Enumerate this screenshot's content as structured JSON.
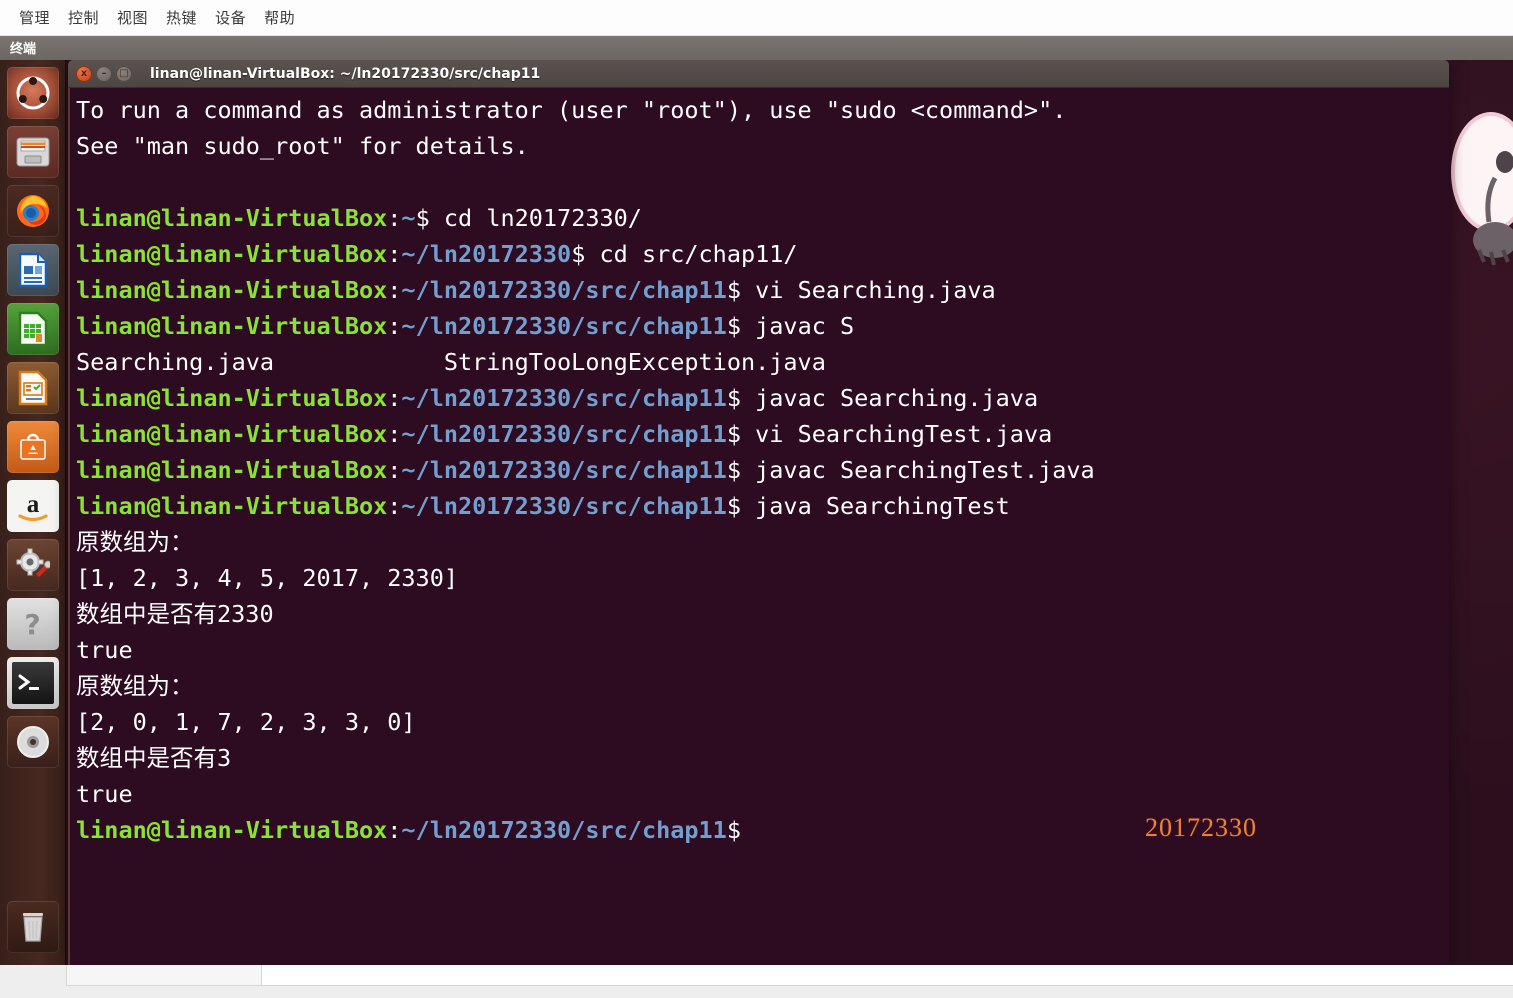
{
  "vbox": {
    "menu_items": [
      "管理",
      "控制",
      "视图",
      "热键",
      "设备",
      "帮助"
    ],
    "tab_label": "终端"
  },
  "terminal": {
    "title": "linan@linan-VirtualBox: ~/ln20172330/src/chap11",
    "bg_color": "#2d0b21",
    "prompt_user_color": "#8ae234",
    "prompt_path_color": "#729fcf",
    "text_color": "#ffffff",
    "close_label": "x",
    "minimize_label": "–",
    "maximize_label": "□",
    "lines": [
      {
        "parts": [
          {
            "t": "To run a command as administrator (user \"root\"), use \"sudo <command>\".",
            "c": "cw"
          }
        ]
      },
      {
        "parts": [
          {
            "t": "See \"man sudo_root\" for details.",
            "c": "cw"
          }
        ]
      },
      {
        "parts": [
          {
            "t": "",
            "c": "cw"
          }
        ]
      },
      {
        "parts": [
          {
            "t": "linan@linan-VirtualBox",
            "c": "cg"
          },
          {
            "t": ":",
            "c": "cw"
          },
          {
            "t": "~",
            "c": "cb"
          },
          {
            "t": "$ cd ln20172330/",
            "c": "cw"
          }
        ]
      },
      {
        "parts": [
          {
            "t": "linan@linan-VirtualBox",
            "c": "cg"
          },
          {
            "t": ":",
            "c": "cw"
          },
          {
            "t": "~/ln20172330",
            "c": "cb"
          },
          {
            "t": "$ cd src/chap11/",
            "c": "cw"
          }
        ]
      },
      {
        "parts": [
          {
            "t": "linan@linan-VirtualBox",
            "c": "cg"
          },
          {
            "t": ":",
            "c": "cw"
          },
          {
            "t": "~/ln20172330/src/chap11",
            "c": "cb"
          },
          {
            "t": "$ vi Searching.java",
            "c": "cw"
          }
        ]
      },
      {
        "parts": [
          {
            "t": "linan@linan-VirtualBox",
            "c": "cg"
          },
          {
            "t": ":",
            "c": "cw"
          },
          {
            "t": "~/ln20172330/src/chap11",
            "c": "cb"
          },
          {
            "t": "$ javac S",
            "c": "cw"
          }
        ]
      },
      {
        "parts": [
          {
            "t": "Searching.java            StringTooLongException.java",
            "c": "cw"
          }
        ]
      },
      {
        "parts": [
          {
            "t": "linan@linan-VirtualBox",
            "c": "cg"
          },
          {
            "t": ":",
            "c": "cw"
          },
          {
            "t": "~/ln20172330/src/chap11",
            "c": "cb"
          },
          {
            "t": "$ javac Searching.java",
            "c": "cw"
          }
        ]
      },
      {
        "parts": [
          {
            "t": "linan@linan-VirtualBox",
            "c": "cg"
          },
          {
            "t": ":",
            "c": "cw"
          },
          {
            "t": "~/ln20172330/src/chap11",
            "c": "cb"
          },
          {
            "t": "$ vi SearchingTest.java",
            "c": "cw"
          }
        ]
      },
      {
        "parts": [
          {
            "t": "linan@linan-VirtualBox",
            "c": "cg"
          },
          {
            "t": ":",
            "c": "cw"
          },
          {
            "t": "~/ln20172330/src/chap11",
            "c": "cb"
          },
          {
            "t": "$ javac SearchingTest.java",
            "c": "cw"
          }
        ]
      },
      {
        "parts": [
          {
            "t": "linan@linan-VirtualBox",
            "c": "cg"
          },
          {
            "t": ":",
            "c": "cw"
          },
          {
            "t": "~/ln20172330/src/chap11",
            "c": "cb"
          },
          {
            "t": "$ java SearchingTest",
            "c": "cw"
          }
        ]
      },
      {
        "parts": [
          {
            "t": "原数组为：",
            "c": "cw"
          }
        ]
      },
      {
        "parts": [
          {
            "t": "[1, 2, 3, 4, 5, 2017, 2330]",
            "c": "cw"
          }
        ]
      },
      {
        "parts": [
          {
            "t": "数组中是否有2330",
            "c": "cw"
          }
        ]
      },
      {
        "parts": [
          {
            "t": "true",
            "c": "cw"
          }
        ]
      },
      {
        "parts": [
          {
            "t": "原数组为：",
            "c": "cw"
          }
        ]
      },
      {
        "parts": [
          {
            "t": "[2, 0, 1, 7, 2, 3, 3, 0]",
            "c": "cw"
          }
        ]
      },
      {
        "parts": [
          {
            "t": "数组中是否有3",
            "c": "cw"
          }
        ]
      },
      {
        "parts": [
          {
            "t": "true",
            "c": "cw"
          }
        ]
      },
      {
        "parts": [
          {
            "t": "linan@linan-VirtualBox",
            "c": "cg"
          },
          {
            "t": ":",
            "c": "cw"
          },
          {
            "t": "~/ln20172330/src/chap11",
            "c": "cb"
          },
          {
            "t": "$ ",
            "c": "cw"
          }
        ]
      }
    ]
  },
  "watermark": {
    "text": "20172330",
    "color": "#e8823c"
  },
  "launcher": {
    "items": [
      {
        "name": "ubuntu-dash-icon",
        "label": "Ubuntu Dash",
        "state": ""
      },
      {
        "name": "files-icon",
        "label": "Files",
        "state": "running"
      },
      {
        "name": "firefox-icon",
        "label": "Firefox Web Browser",
        "state": ""
      },
      {
        "name": "libreoffice-writer-icon",
        "label": "LibreOffice Writer",
        "state": ""
      },
      {
        "name": "libreoffice-calc-icon",
        "label": "LibreOffice Calc",
        "state": ""
      },
      {
        "name": "libreoffice-impress-icon",
        "label": "LibreOffice Impress",
        "state": ""
      },
      {
        "name": "ubuntu-software-icon",
        "label": "Ubuntu Software",
        "state": ""
      },
      {
        "name": "amazon-icon",
        "label": "Amazon",
        "state": ""
      },
      {
        "name": "system-settings-icon",
        "label": "System Settings",
        "state": ""
      },
      {
        "name": "help-icon",
        "label": "Ubuntu Help",
        "state": "running"
      },
      {
        "name": "terminal-icon",
        "label": "Terminal",
        "state": "active"
      },
      {
        "name": "disc-icon",
        "label": "Disc Image",
        "state": ""
      }
    ],
    "trash": {
      "name": "trash-icon",
      "label": "Trash"
    }
  }
}
